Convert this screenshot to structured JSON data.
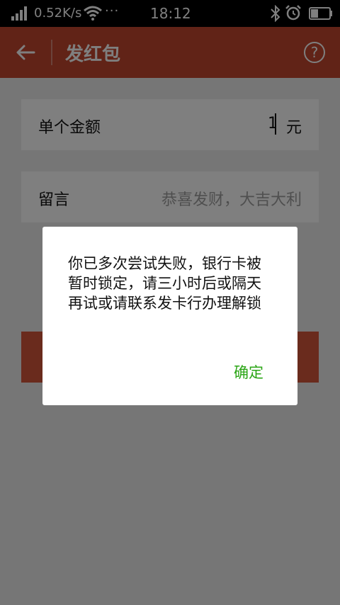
{
  "statusbar": {
    "speed": "0.52K/s",
    "more": "···",
    "time": "18:12",
    "icons": [
      "signal-icon",
      "wifi-icon",
      "bluetooth-icon",
      "alarm-icon",
      "battery-icon"
    ]
  },
  "header": {
    "title": "发红包",
    "help": "?",
    "bg_color": "#c2472f"
  },
  "form": {
    "amount_label": "单个金额",
    "amount_value": "1",
    "amount_unit": "元",
    "message_label": "留言",
    "message_placeholder": "恭喜发财，大吉大利"
  },
  "dialog": {
    "message": "你已多次尝试失败，银行卡被暂时锁定，请三小时后或隔天再试或请联系发卡行办理解锁",
    "confirm": "确定",
    "confirm_color": "#2aa515"
  }
}
